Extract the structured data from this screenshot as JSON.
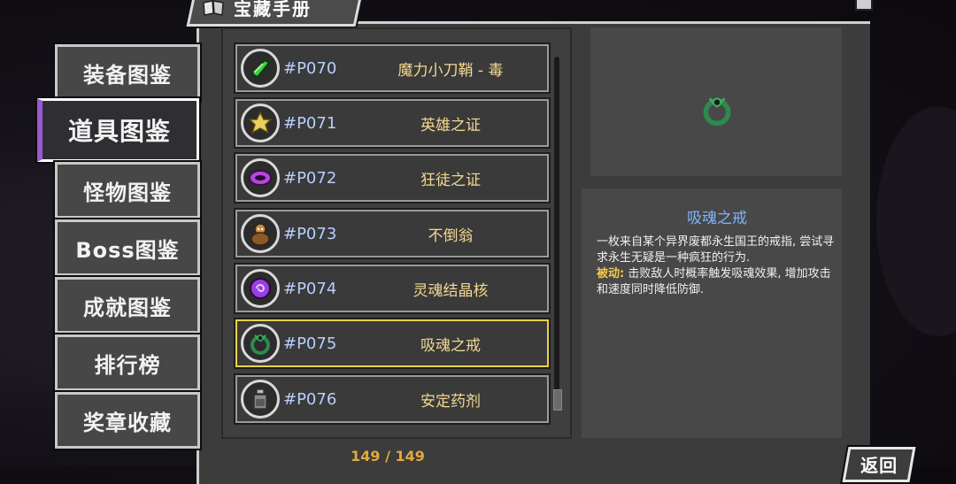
{
  "header": {
    "title": "宝藏手册",
    "icon": "book-icon"
  },
  "side_tabs": [
    {
      "label": "装备图鉴",
      "active": false
    },
    {
      "label": "道具图鉴",
      "active": true
    },
    {
      "label": "怪物图鉴",
      "active": false
    },
    {
      "label": "Boss图鉴",
      "active": false
    },
    {
      "label": "成就图鉴",
      "active": false
    },
    {
      "label": "排行榜",
      "active": false
    },
    {
      "label": "奖章收藏",
      "active": false
    }
  ],
  "items": [
    {
      "code": "#P070",
      "name": "魔力小刀鞘 - 毒",
      "icon": "poison-sheath-icon",
      "color": "#3ccf3c"
    },
    {
      "code": "#P071",
      "name": "英雄之证",
      "icon": "hero-emblem-icon",
      "color": "#e8d060"
    },
    {
      "code": "#P072",
      "name": "狂徒之证",
      "icon": "fanatic-emblem-icon",
      "color": "#b04ad8"
    },
    {
      "code": "#P073",
      "name": "不倒翁",
      "icon": "tumbler-doll-icon",
      "color": "#c89040"
    },
    {
      "code": "#P074",
      "name": "灵魂结晶核",
      "icon": "soul-crystal-icon",
      "color": "#9a3ee0"
    },
    {
      "code": "#P075",
      "name": "吸魂之戒",
      "icon": "soul-ring-icon",
      "color": "#2e8a4e",
      "selected": true
    },
    {
      "code": "#P076",
      "name": "安定药剂",
      "icon": "potion-icon",
      "color": "#9a9a9a"
    }
  ],
  "counter": "149 / 149",
  "detail": {
    "title": "吸魂之戒",
    "description": "一枚来自某个异界废都永生国王的戒指, 尝试寻求永生无疑是一种疯狂的行为.",
    "passive_label": "被动:",
    "passive_text": " 击败敌人时概率触发吸魂效果, 增加攻击和速度同时降低防御."
  },
  "back_label": "返回",
  "colors": {
    "selected_border": "#e7d24a",
    "active_tab_accent": "#9b59d0",
    "code_text": "#b6d0ff",
    "name_text": "#f2d890"
  }
}
